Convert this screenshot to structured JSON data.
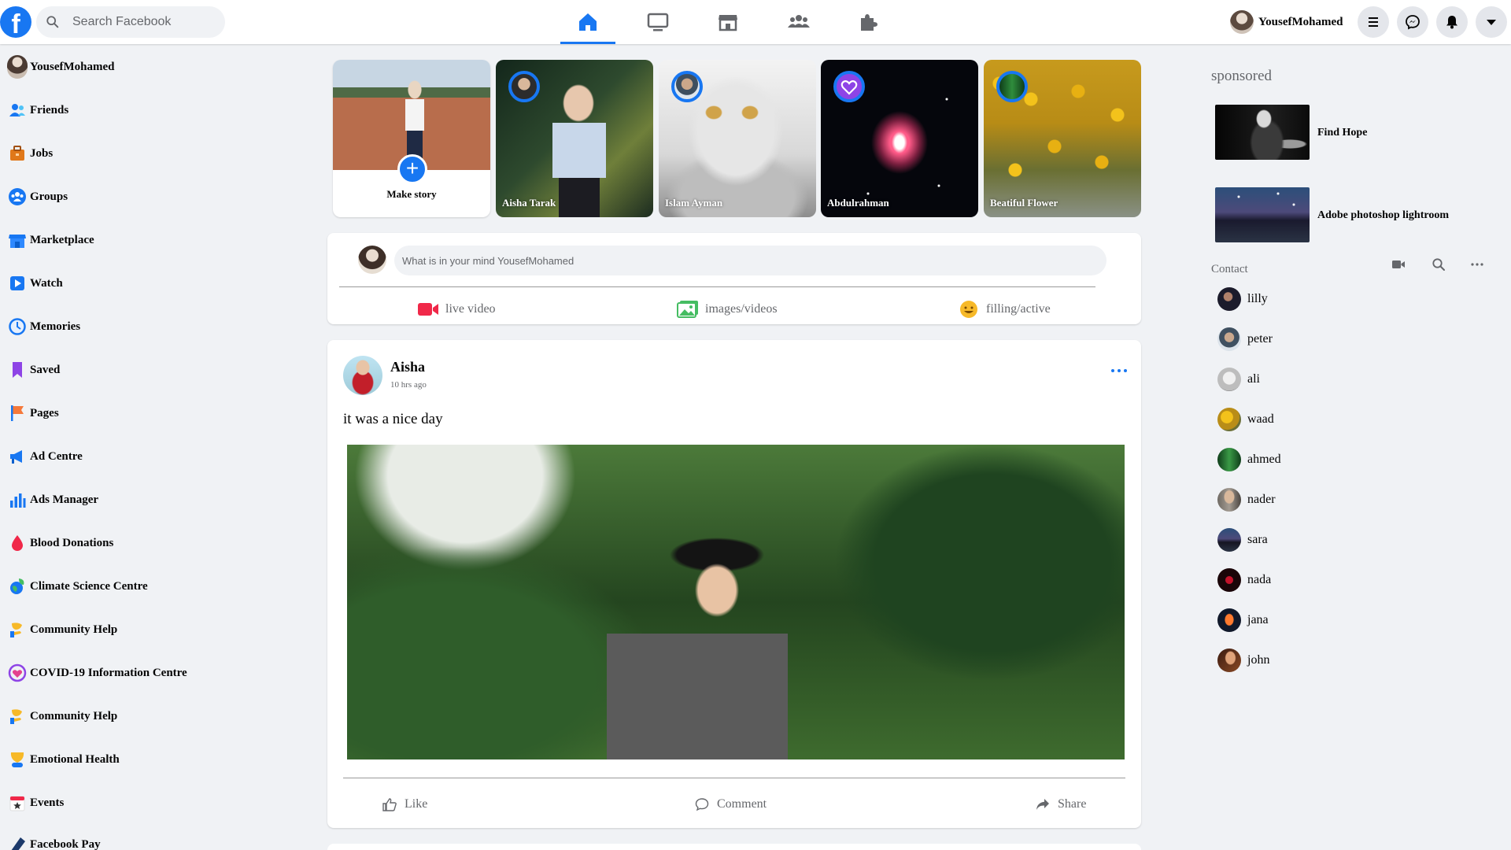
{
  "brand": {
    "logo_letter": "f",
    "color": "#1877f2"
  },
  "search": {
    "placeholder": "Search Facebook"
  },
  "nav_tabs": [
    {
      "name": "home",
      "icon": "home-icon",
      "active": true
    },
    {
      "name": "watch",
      "icon": "tv-icon",
      "active": false
    },
    {
      "name": "marketplace",
      "icon": "store-icon",
      "active": false
    },
    {
      "name": "groups",
      "icon": "people-icon",
      "active": false
    },
    {
      "name": "gaming",
      "icon": "puzzle-icon",
      "active": false
    }
  ],
  "header": {
    "user_name": "YousefMohamed",
    "buttons": [
      "menu-icon",
      "messenger-icon",
      "bell-icon",
      "caret-down-icon"
    ]
  },
  "left_sidebar": {
    "items": [
      {
        "label": "YousefMohamed",
        "icon": "avatar"
      },
      {
        "label": "Friends",
        "icon": "friends-icon"
      },
      {
        "label": "Jobs",
        "icon": "briefcase-icon"
      },
      {
        "label": "Groups",
        "icon": "groups-icon"
      },
      {
        "label": "Marketplace",
        "icon": "store-icon"
      },
      {
        "label": "Watch",
        "icon": "play-icon"
      },
      {
        "label": "Memories",
        "icon": "clock-icon"
      },
      {
        "label": "Saved",
        "icon": "bookmark-icon"
      },
      {
        "label": "Pages",
        "icon": "flag-icon"
      },
      {
        "label": "Ad Centre",
        "icon": "megaphone-icon"
      },
      {
        "label": "Ads Manager",
        "icon": "bar-chart-icon"
      },
      {
        "label": "Blood Donations",
        "icon": "blood-drop-icon"
      },
      {
        "label": "Climate Science Centre",
        "icon": "globe-leaf-icon"
      },
      {
        "label": "Community Help",
        "icon": "hand-heart-icon"
      },
      {
        "label": "COVID-19 Information Centre",
        "icon": "heart-shield-icon"
      },
      {
        "label": "Community Help",
        "icon": "hand-heart-icon"
      },
      {
        "label": "Emotional Health",
        "icon": "emotional-health-icon"
      },
      {
        "label": "Events",
        "icon": "calendar-icon"
      },
      {
        "label": "Facebook Pay",
        "icon": "pay-icon"
      }
    ]
  },
  "stories": {
    "make_story_label": "Make story",
    "items": [
      {
        "name": "Aisha Tarak"
      },
      {
        "name": "Islam Ayman"
      },
      {
        "name": "Abdulrahman"
      },
      {
        "name": "Beatiful Flower"
      }
    ]
  },
  "composer": {
    "placeholder": "What is in your mind YousefMohamed",
    "actions": [
      {
        "label": "live video",
        "icon": "video-camera-icon",
        "color": "#f02849"
      },
      {
        "label": "images/videos",
        "icon": "photo-icon",
        "color": "#45bd62"
      },
      {
        "label": "filling/active",
        "icon": "smiley-icon",
        "color": "#f7b928"
      }
    ]
  },
  "post": {
    "author": "Aisha",
    "time": "10 hrs ago",
    "text": "it was a nice day",
    "actions": [
      {
        "label": "Like",
        "icon": "thumbs-up-icon"
      },
      {
        "label": "Comment",
        "icon": "comment-icon"
      },
      {
        "label": "Share",
        "icon": "share-icon"
      }
    ]
  },
  "right_sidebar": {
    "sponsored_title": "sponsored",
    "ads": [
      {
        "title": "Find Hope"
      },
      {
        "title": "Adobe photoshop lightroom"
      }
    ],
    "contact_title": "Contact",
    "contact_tools": [
      "video-camera-icon",
      "search-icon",
      "more-horizontal-icon"
    ],
    "contacts": [
      "lilly",
      "peter",
      "ali",
      "waad",
      "ahmed",
      "nader",
      "sara",
      "nada",
      "jana",
      "john"
    ]
  }
}
